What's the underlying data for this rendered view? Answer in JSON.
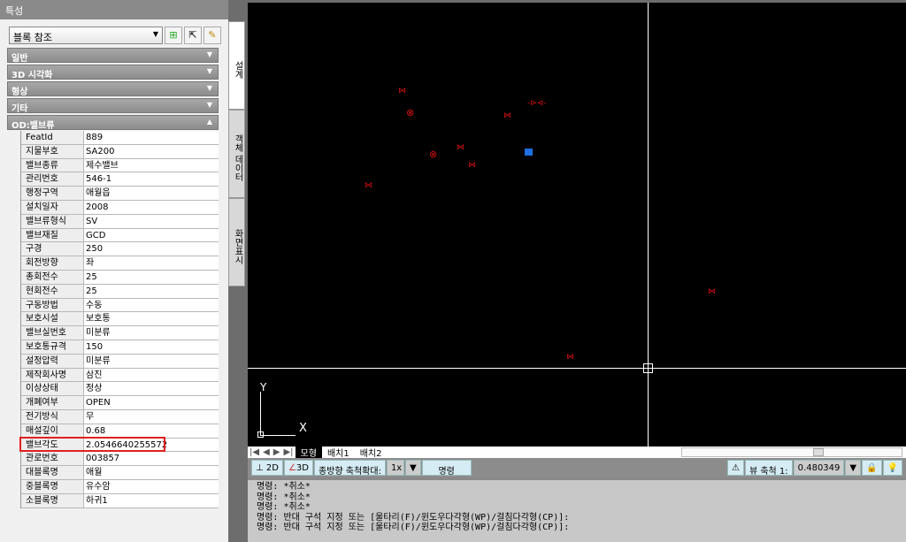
{
  "panel": {
    "title": "특성",
    "selector": "블록 참조",
    "categories": [
      "일반",
      "3D 시각화",
      "형상",
      "기타",
      "OD:밸브류"
    ]
  },
  "side_tabs": [
    "설계",
    "객체 데이터",
    "화면표시"
  ],
  "properties": [
    [
      "FeatId",
      "889"
    ],
    [
      "지물부호",
      "SA200"
    ],
    [
      "밸브종류",
      "제수밸브"
    ],
    [
      "관리번호",
      "546-1"
    ],
    [
      "행정구역",
      "애월읍"
    ],
    [
      "설치일자",
      "2008"
    ],
    [
      "밸브류형식",
      "SV"
    ],
    [
      "밸브재질",
      "GCD"
    ],
    [
      "구경",
      "250"
    ],
    [
      "회전방향",
      "좌"
    ],
    [
      "총회전수",
      "25"
    ],
    [
      "현회전수",
      "25"
    ],
    [
      "구동방법",
      "수동"
    ],
    [
      "보호시설",
      "보호통"
    ],
    [
      "밸브실번호",
      "미분류"
    ],
    [
      "보호통규격",
      "150"
    ],
    [
      "설정압력",
      "미분류"
    ],
    [
      "제작회사명",
      "삼진"
    ],
    [
      "이상상태",
      "정상"
    ],
    [
      "개폐여부",
      "OPEN"
    ],
    [
      "전기방식",
      "무"
    ],
    [
      "매설깊이",
      "0.68"
    ],
    [
      "밸브각도",
      "2.0546640255572"
    ],
    [
      "관로번호",
      "003857"
    ],
    [
      "대블록명",
      "애월"
    ],
    [
      "중블록명",
      "유수암"
    ],
    [
      "소블록명",
      "하귀1"
    ]
  ],
  "layout_tabs": [
    "모형",
    "배치1",
    "배치2"
  ],
  "toolbar": {
    "btn2d": "2D",
    "btn3d": "3D",
    "zoom_label": "종방향 축척확대:",
    "zoom_value": "1x",
    "command": "명령",
    "view_scale_label": "뷰 축척 1:",
    "view_scale_value": "0.480349"
  },
  "ucs": {
    "y": "Y",
    "x": "X"
  },
  "command_history": [
    "명령: *취소*",
    "명령: *취소*",
    "명령: *취소*",
    "명령: 반대 구석 지정 또는 [울타리(F)/윈도우다각형(WP)/걸침다각형(CP)]:",
    "명령: 반대 구석 지정 또는 [울타리(F)/윈도우다각형(WP)/걸침다각형(CP)]:"
  ]
}
